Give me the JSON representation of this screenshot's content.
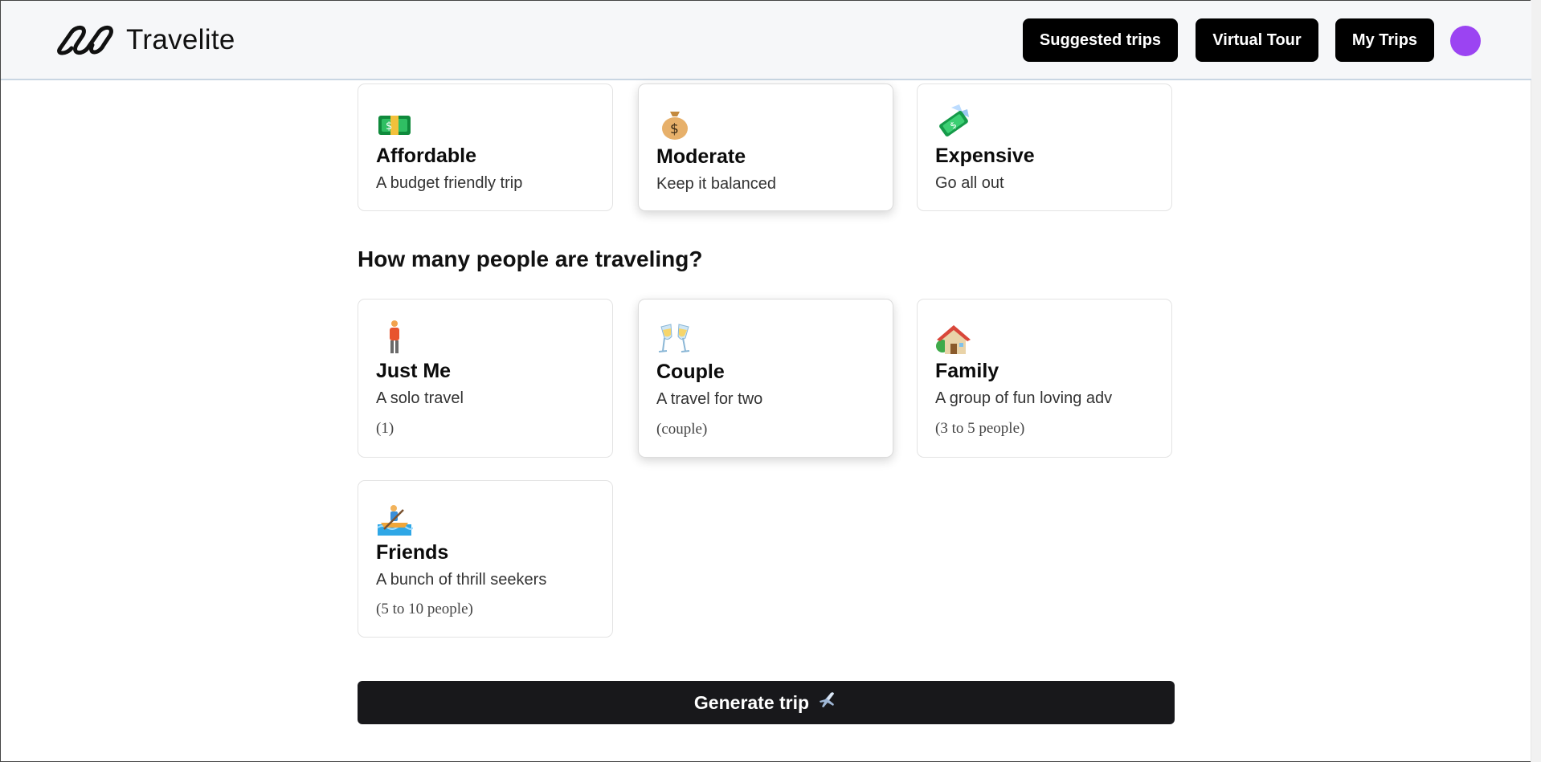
{
  "header": {
    "brand_name": "Travelite",
    "nav": [
      {
        "label": "Suggested trips"
      },
      {
        "label": "Virtual Tour"
      },
      {
        "label": "My Trips"
      }
    ],
    "avatar_color": "#9b44f2"
  },
  "budget": {
    "options": [
      {
        "icon": "money-bill-icon",
        "title": "Affordable",
        "desc": "A budget friendly trip",
        "selected": false
      },
      {
        "icon": "money-bag-icon",
        "title": "Moderate",
        "desc": "Keep it balanced",
        "selected": true
      },
      {
        "icon": "money-wings-icon",
        "title": "Expensive",
        "desc": "Go all out",
        "selected": false
      }
    ]
  },
  "travelers": {
    "question": "How many people are traveling?",
    "options": [
      {
        "icon": "person-icon",
        "title": "Just Me",
        "desc": "A solo travel",
        "count": "(1)",
        "selected": false
      },
      {
        "icon": "champagne-glasses-icon",
        "title": "Couple",
        "desc": "A travel for two",
        "count": "(couple)",
        "selected": true
      },
      {
        "icon": "house-icon",
        "title": "Family",
        "desc": "A group of fun loving adv",
        "count": "(3 to 5 people)",
        "selected": false
      },
      {
        "icon": "rowboat-icon",
        "title": "Friends",
        "desc": "A bunch of thrill seekers",
        "count": "(5 to 10 people)",
        "selected": false
      }
    ]
  },
  "generate": {
    "label": "Generate trip",
    "icon": "airplane-icon"
  }
}
